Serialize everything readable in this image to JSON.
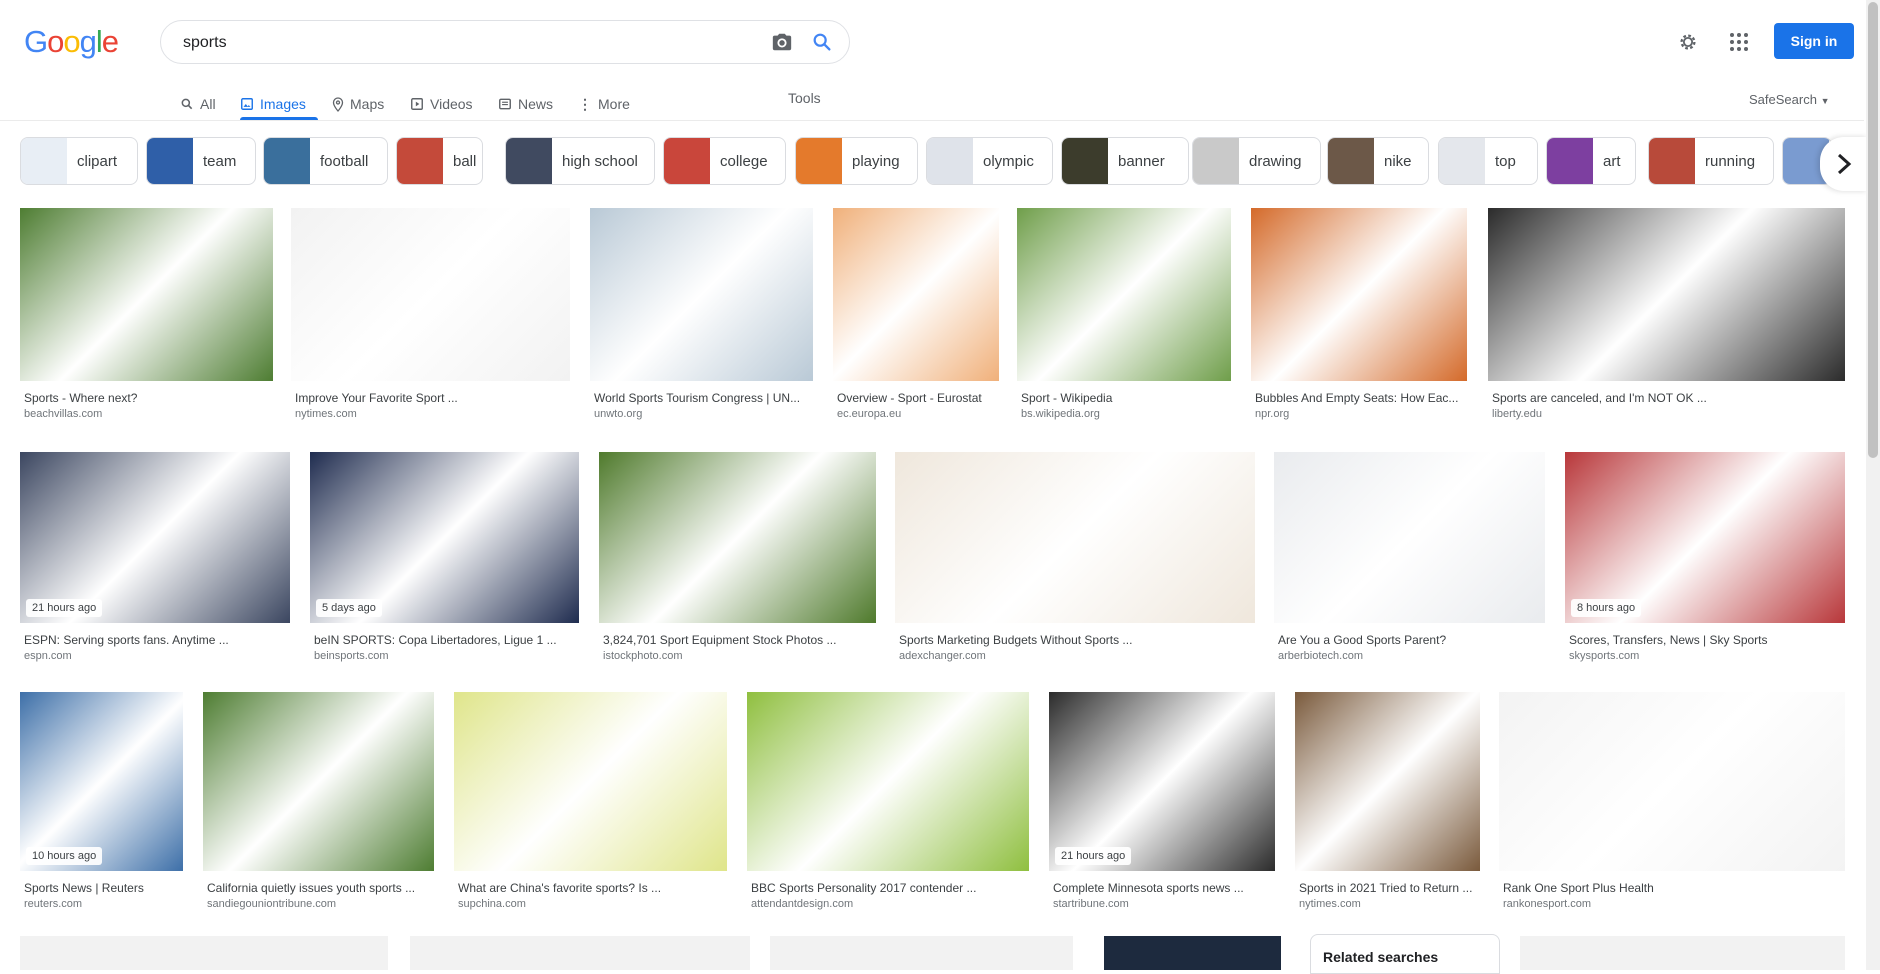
{
  "logo": {
    "letters": [
      "G",
      "o",
      "o",
      "g",
      "l",
      "e"
    ],
    "colors": [
      "#4285f4",
      "#ea4335",
      "#fbbc05",
      "#4285f4",
      "#34a853",
      "#ea4335"
    ]
  },
  "search": {
    "query": "sports"
  },
  "header": {
    "signin": "Sign in"
  },
  "tabs": [
    "All",
    "Images",
    "Maps",
    "Videos",
    "News",
    "More"
  ],
  "tools": "Tools",
  "safesearch": "SafeSearch",
  "chips": [
    "clipart",
    "team",
    "football",
    "ball",
    "high school",
    "college",
    "playing",
    "olympic",
    "banner",
    "drawing",
    "nike",
    "top",
    "art",
    "running"
  ],
  "row1": [
    {
      "cap": "Sports - Where next?",
      "src": "beachvillas.com",
      "badge": "",
      "color": "#4e7d32"
    },
    {
      "cap": "Improve Your Favorite Sport ...",
      "src": "nytimes.com",
      "badge": "",
      "color": "#f2f2f2"
    },
    {
      "cap": "World Sports Tourism Congress | UN...",
      "src": "unwto.org",
      "badge": "",
      "color": "#b9c9d6"
    },
    {
      "cap": "Overview - Sport - Eurostat",
      "src": "ec.europa.eu",
      "badge": "",
      "color": "#f0b07a"
    },
    {
      "cap": "Sport - Wikipedia",
      "src": "bs.wikipedia.org",
      "badge": "",
      "color": "#6f9e4a"
    },
    {
      "cap": "Bubbles And Empty Seats: How Eac...",
      "src": "npr.org",
      "badge": "",
      "color": "#d46a2a"
    },
    {
      "cap": "Sports are canceled, and I'm NOT OK ...",
      "src": "liberty.edu",
      "badge": "",
      "color": "#2b2b2b"
    }
  ],
  "row2": [
    {
      "cap": "ESPN: Serving sports fans. Anytime ...",
      "src": "espn.com",
      "badge": "21 hours ago",
      "color": "#3b4660"
    },
    {
      "cap": "beIN SPORTS: Copa Libertadores, Ligue 1 ...",
      "src": "beinsports.com",
      "badge": "5 days ago",
      "color": "#1f2c4f"
    },
    {
      "cap": "3,824,701 Sport Equipment Stock Photos ...",
      "src": "istockphoto.com",
      "badge": "",
      "color": "#4f7a2c"
    },
    {
      "cap": "Sports Marketing Budgets Without Sports ...",
      "src": "adexchanger.com",
      "badge": "",
      "color": "#efe7dc"
    },
    {
      "cap": "Are You a Good Sports Parent?",
      "src": "arberbiotech.com",
      "badge": "",
      "color": "#e9ebee"
    },
    {
      "cap": "Scores, Transfers, News | Sky Sports",
      "src": "skysports.com",
      "badge": "8 hours ago",
      "color": "#b8373a"
    }
  ],
  "row3": [
    {
      "cap": "Sports News | Reuters",
      "src": "reuters.com",
      "badge": "10 hours ago",
      "color": "#3d6fa8"
    },
    {
      "cap": "California quietly issues youth sports ...",
      "src": "sandiegouniontribune.com",
      "badge": "",
      "color": "#4e7d32"
    },
    {
      "cap": "What are China's favorite sports? Is ...",
      "src": "supchina.com",
      "badge": "",
      "color": "#dfe58a"
    },
    {
      "cap": "BBC Sports Personality 2017 contender ...",
      "src": "attendantdesign.com",
      "badge": "",
      "color": "#8fbf3f"
    },
    {
      "cap": "Complete Minnesota sports news ...",
      "src": "startribune.com",
      "badge": "21 hours ago",
      "color": "#2b2b2b"
    },
    {
      "cap": "Sports in 2021 Tried to Return ...",
      "src": "nytimes.com",
      "badge": "",
      "color": "#7a5a3c"
    },
    {
      "cap": "Rank One Sport Plus Health",
      "src": "rankonesport.com",
      "badge": "",
      "color": "#f3f3f3"
    }
  ],
  "related": "Related searches"
}
